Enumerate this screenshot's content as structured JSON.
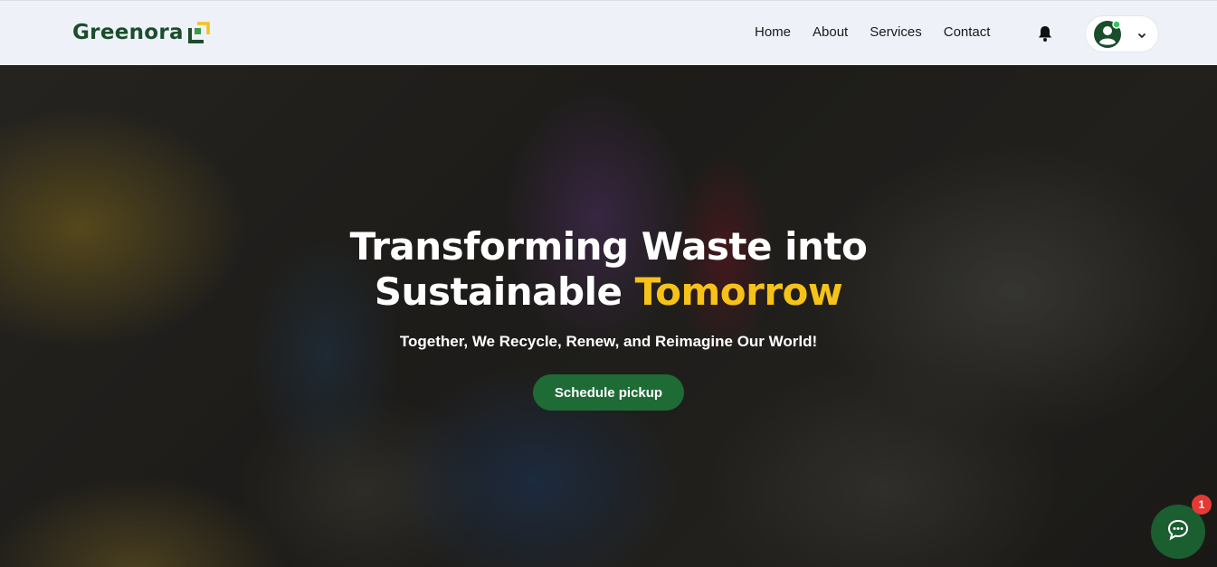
{
  "brand": {
    "name": "Greenora",
    "logo_colors": [
      "#1b4d2b",
      "#f6c21a",
      "#3a9a4a"
    ]
  },
  "nav": {
    "links": [
      {
        "label": "Home"
      },
      {
        "label": "About"
      },
      {
        "label": "Services"
      },
      {
        "label": "Contact"
      }
    ],
    "bell_icon": "bell-icon",
    "profile": {
      "avatar_icon": "user-avatar-icon",
      "status": "online",
      "chevron_icon": "chevron-down-icon"
    }
  },
  "hero": {
    "title_line1": "Transforming Waste into",
    "title_line2_plain": "Sustainable ",
    "title_line2_accent": "Tomorrow",
    "subtitle": "Together, We Recycle, Renew, and Reimagine Our World!",
    "cta_label": "Schedule pickup",
    "accent_color": "#f6c21a",
    "cta_color": "#1e6b35"
  },
  "chat": {
    "icon": "chat-bubble-icon",
    "badge_count": "1"
  }
}
